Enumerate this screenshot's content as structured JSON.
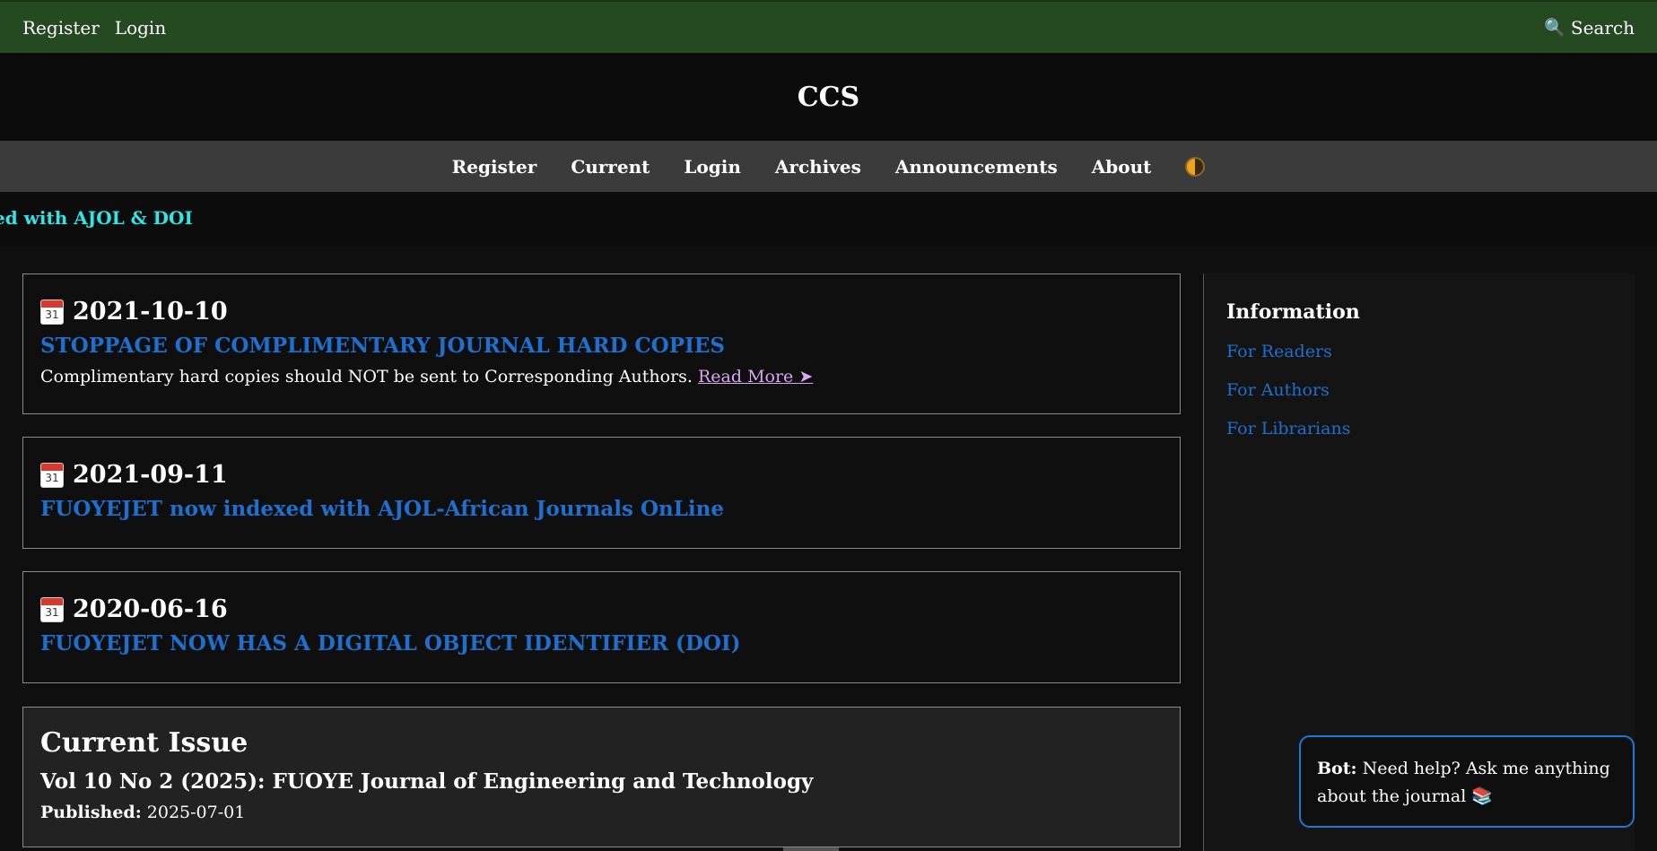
{
  "topbar": {
    "register_label": "Register",
    "login_label": "Login",
    "search_label": "Search",
    "search_icon": "magnifier-icon"
  },
  "header": {
    "site_title": "CCS"
  },
  "nav": {
    "items": [
      "Register",
      "Current",
      "Login",
      "Archives",
      "Announcements",
      "About"
    ],
    "theme_toggle_icon": "theme-toggle-icon"
  },
  "ticker": {
    "text": "ed with AJOL & DOI"
  },
  "announcements": [
    {
      "date": "2021-10-10",
      "title": "STOPPAGE OF COMPLIMENTARY JOURNAL HARD COPIES",
      "description": "Complimentary hard copies should NOT be sent to Corresponding Authors.",
      "read_more": "Read More ➤"
    },
    {
      "date": "2021-09-11",
      "title": "FUOYEJET now indexed with AJOL-African Journals OnLine"
    },
    {
      "date": "2020-06-16",
      "title": "FUOYEJET NOW HAS A DIGITAL OBJECT IDENTIFIER (DOI)"
    }
  ],
  "current_issue": {
    "heading": "Current Issue",
    "issue": "Vol 10 No 2 (2025): FUOYE Journal of Engineering and Technology",
    "published_label": "Published:",
    "published_date": "2025-07-01"
  },
  "sidebar": {
    "title": "Information",
    "links": [
      "For Readers",
      "For Authors",
      "For Librarians"
    ]
  },
  "bot": {
    "label": "Bot:",
    "message": "Need help? Ask me anything about the journal 📚"
  },
  "colors": {
    "topbar_bg": "#254a22",
    "link_blue": "#1f6fcf",
    "ticker_cyan": "#2ee6e6",
    "read_more": "#d8a8f0"
  }
}
